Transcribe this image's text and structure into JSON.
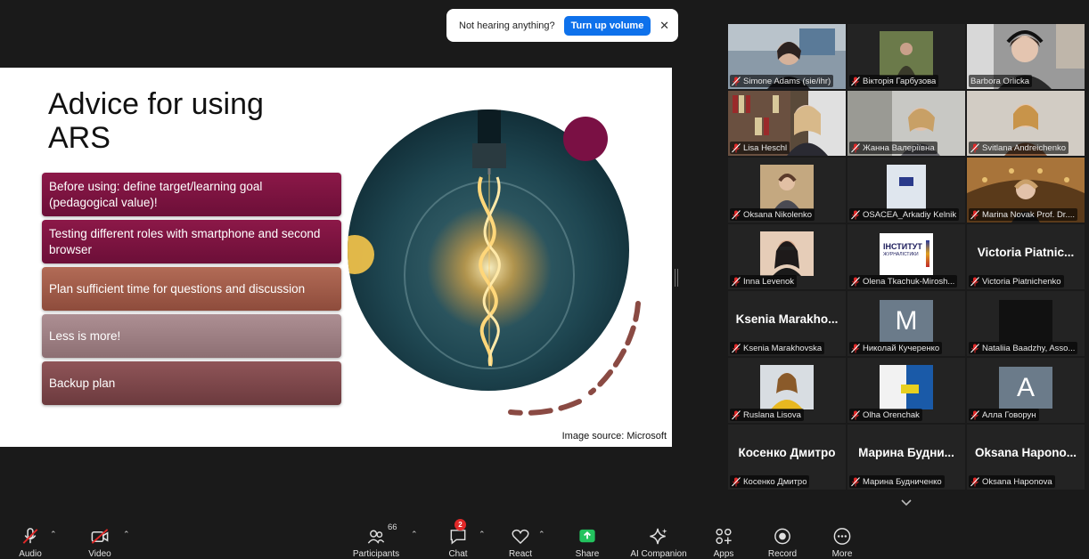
{
  "notification": {
    "text": "Not hearing anything?",
    "button": "Turn up volume"
  },
  "slide": {
    "title_line1": "Advice for using",
    "title_line2": "ARS",
    "bullets": [
      "Before using: define target/learning goal (pedagogical value)!",
      "Testing different roles with smartphone and second browser",
      "Plan sufficient time for questions and discussion",
      "Less is more!",
      "Backup plan"
    ],
    "image_source": "Image source: Microsoft"
  },
  "participants": [
    {
      "name": "Simone Adams (sie/ihr)",
      "muted": true
    },
    {
      "name": "Вікторія Гарбузова",
      "muted": true
    },
    {
      "name": "Barbora Orlicka",
      "muted": false
    },
    {
      "name": "Lisa Heschl",
      "muted": true
    },
    {
      "name": "Жанна Валеріївна",
      "muted": true
    },
    {
      "name": "Svitlana Andreichenko",
      "muted": true
    },
    {
      "name": "Oksana Nikolenko",
      "muted": true
    },
    {
      "name": "OSACEA_Arkadiy Kelnik",
      "muted": true
    },
    {
      "name": "Marina Novak Prof. Dr....",
      "muted": true
    },
    {
      "name": "Inna Levenok",
      "muted": true
    },
    {
      "name": "Olena Tkachuk-Mirosh...",
      "muted": true
    },
    {
      "name": "Victoria Piatnichenko",
      "muted": true,
      "bigname": "Victoria Piatnic..."
    },
    {
      "name": "Ksenia Marakhovska",
      "muted": true,
      "bigname": "Ksenia Marakho..."
    },
    {
      "name": "Николай Кучеренко",
      "muted": true,
      "letter": "M"
    },
    {
      "name": "Nataliia Baadzhy, Asso...",
      "muted": true
    },
    {
      "name": "Ruslana Lisova",
      "muted": true
    },
    {
      "name": "Olha Orenchak",
      "muted": true
    },
    {
      "name": "Алла Говорун",
      "muted": true,
      "letter": "A"
    },
    {
      "name": "Косенко Дмитро",
      "muted": true,
      "bigname": "Косенко Дмитро"
    },
    {
      "name": "Марина Будниченко",
      "muted": true,
      "bigname": "Марина Будни..."
    },
    {
      "name": "Oksana Haponova",
      "muted": true,
      "bigname": "Oksana Hapono..."
    }
  ],
  "logo_text": {
    "line1": "ІНСТИТУТ",
    "line2": "ЖУРНАЛІСТИКИ"
  },
  "toolbar": {
    "audio": "Audio",
    "video": "Video",
    "participants": "Participants",
    "participants_count": "66",
    "chat": "Chat",
    "chat_badge": "2",
    "react": "React",
    "share": "Share",
    "ai_companion": "AI Companion",
    "apps": "Apps",
    "record": "Record",
    "more": "More"
  }
}
